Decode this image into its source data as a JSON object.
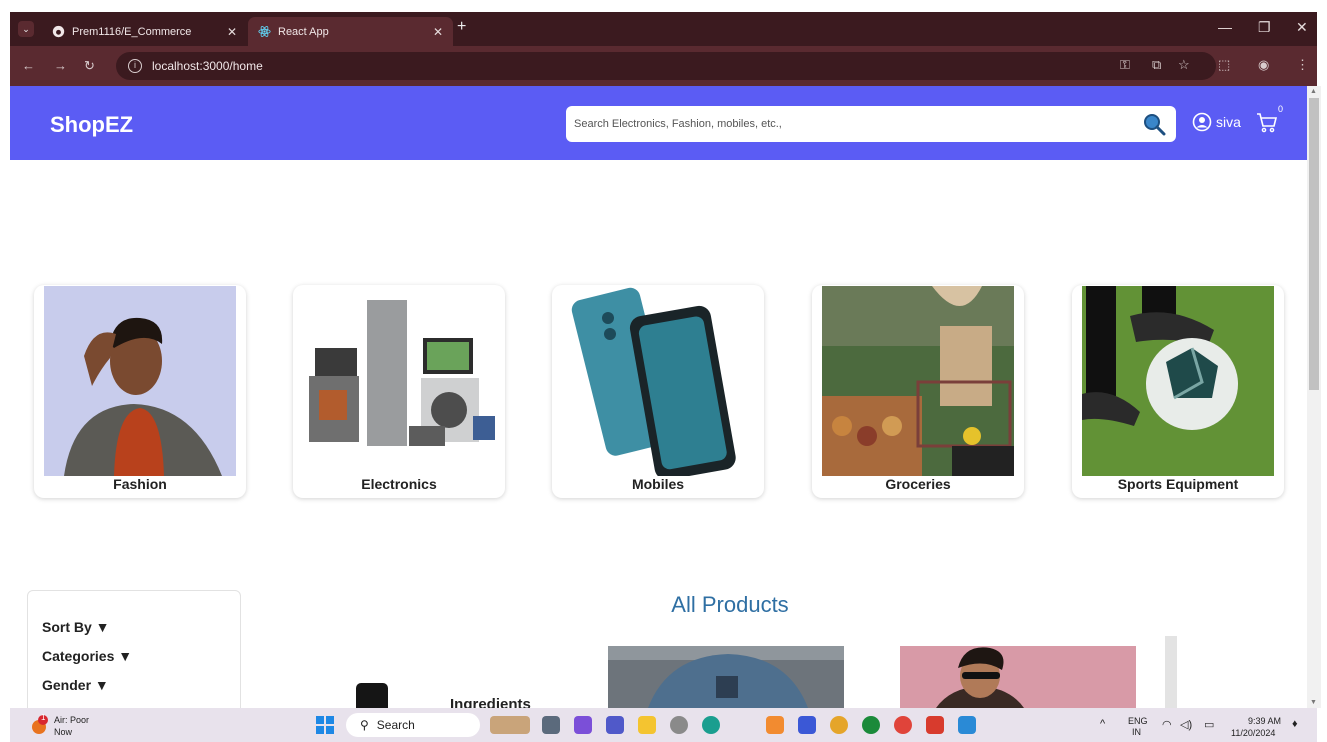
{
  "browser": {
    "tabs": [
      {
        "title": "Prem1116/E_Commerce",
        "icon": "github-icon"
      },
      {
        "title": "React App",
        "icon": "react-icon",
        "active": true
      }
    ],
    "new_tab": "+",
    "url": "localhost:3000/home"
  },
  "header": {
    "logo": "ShopEZ",
    "search_placeholder": "Search Electronics, Fashion, mobiles, etc.,",
    "user_name": "siva",
    "cart_count": "0",
    "color": "#5b5cf4"
  },
  "categories": [
    {
      "label": "Fashion",
      "icon": "fashion-image"
    },
    {
      "label": "Electronics",
      "icon": "electronics-image"
    },
    {
      "label": "Mobiles",
      "icon": "mobiles-image"
    },
    {
      "label": "Groceries",
      "icon": "groceries-image"
    },
    {
      "label": "Sports Equipment",
      "icon": "sports-image"
    }
  ],
  "filters": {
    "sort_by": "Sort By ▼",
    "categories": "Categories ▼",
    "gender": "Gender ▼"
  },
  "products": {
    "title": "All Products",
    "partial_text": "Ingredients"
  },
  "taskbar": {
    "weather": "Air: Poor",
    "weather_sub": "Now",
    "weather_badge": "1",
    "search": "Search",
    "lang": "ENG",
    "region": "IN",
    "time": "9:39 AM",
    "date": "11/20/2024"
  }
}
